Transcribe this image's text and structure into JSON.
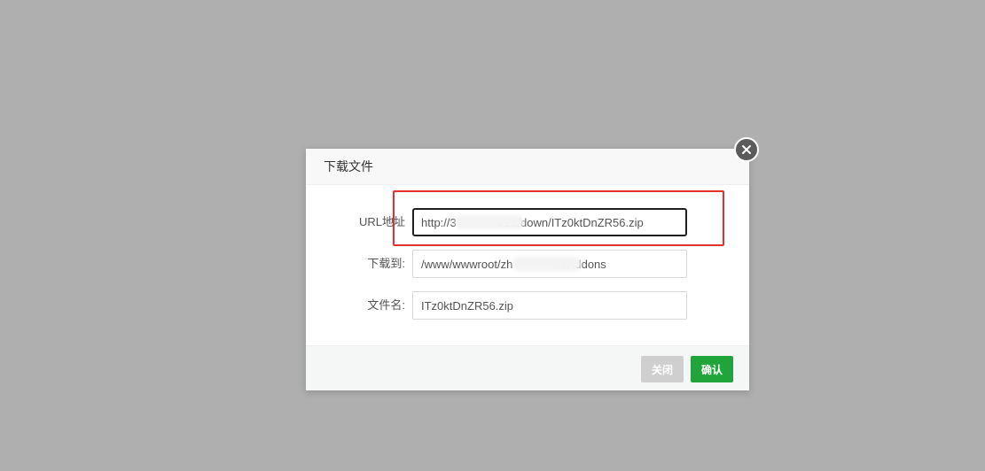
{
  "dialog": {
    "title": "下载文件",
    "fields": {
      "url": {
        "label": "URL地址",
        "value": "http://3             918/down/ITz0ktDnZR56.zip"
      },
      "path": {
        "label": "下载到:",
        "value": "/www/wwwroot/zh             m/Addons"
      },
      "filename": {
        "label": "文件名:",
        "value": "ITz0ktDnZR56.zip"
      }
    },
    "buttons": {
      "close": "关闭",
      "confirm": "确认"
    }
  },
  "colors": {
    "overlay": "#afafaf",
    "confirm": "#20a53a",
    "close_button": "#cfcfcf",
    "highlight": "#e23030"
  },
  "icons": {
    "close": "close-icon"
  }
}
